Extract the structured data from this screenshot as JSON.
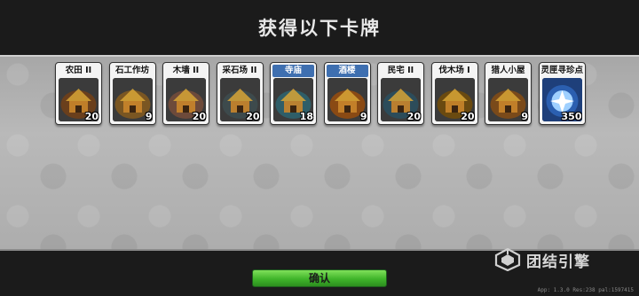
{
  "title": "获得以下卡牌",
  "cards": [
    {
      "label": "农田 II",
      "count": "20",
      "header": "white",
      "icon": "farm-icon",
      "color": "#6a3f1c"
    },
    {
      "label": "石工作坊",
      "count": "9",
      "header": "white",
      "icon": "stone-workshop-icon",
      "color": "#7a5622"
    },
    {
      "label": "木墙 II",
      "count": "20",
      "header": "white",
      "icon": "wood-wall-icon",
      "color": "#6d4a3a"
    },
    {
      "label": "采石场 II",
      "count": "20",
      "header": "white",
      "icon": "quarry-icon",
      "color": "#3d4a4c"
    },
    {
      "label": "寺庙",
      "count": "18",
      "header": "blue",
      "icon": "temple-icon",
      "color": "#2f5e68"
    },
    {
      "label": "酒楼",
      "count": "9",
      "header": "blue",
      "icon": "tavern-icon",
      "color": "#8a4a14"
    },
    {
      "label": "民宅 II",
      "count": "20",
      "header": "white",
      "icon": "house-icon",
      "color": "#2c4c5a"
    },
    {
      "label": "伐木场 I",
      "count": "20",
      "header": "white",
      "icon": "lumber-mill-icon",
      "color": "#6a4a10"
    },
    {
      "label": "猎人小屋",
      "count": "9",
      "header": "white",
      "icon": "hunter-hut-icon",
      "color": "#7a4a1a"
    },
    {
      "label": "灵匣寻珍点数",
      "count": "350",
      "header": "white",
      "icon": "crystal-icon",
      "color": "#2b5fb0"
    }
  ],
  "confirm_label": "确认",
  "brand_name": "团结引擎",
  "version_text": "App: 1.3.0 Res:238 pal:1597415"
}
